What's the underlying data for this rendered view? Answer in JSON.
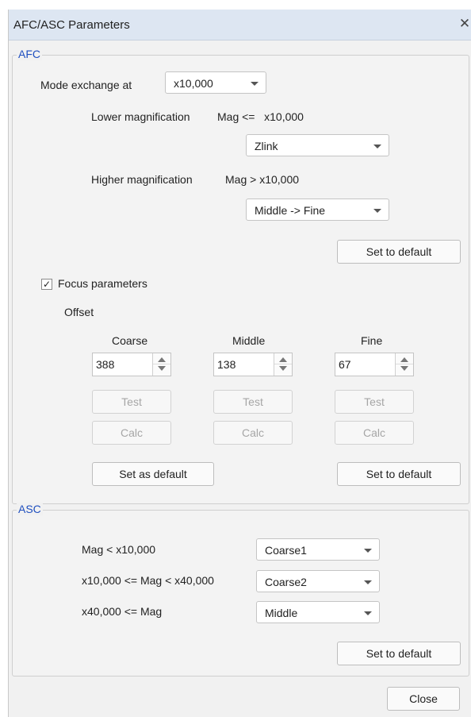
{
  "window": {
    "title": "AFC/ASC Parameters",
    "close_glyph": "✕"
  },
  "afc": {
    "legend": "AFC",
    "mode_exchange_label": "Mode exchange at",
    "mode_exchange_value": "x10,000",
    "lower_mag_label": "Lower magnification",
    "lower_mag_condition": "Mag <=   x10,000",
    "lower_mag_value": "Zlink",
    "higher_mag_label": "Higher magnification",
    "higher_mag_condition": "Mag > x10,000",
    "higher_mag_value": "Middle -> Fine",
    "set_default_label": "Set to default",
    "focus_params_label": "Focus parameters",
    "focus_params_checked": true,
    "check_glyph": "✓",
    "offset_label": "Offset",
    "columns": [
      {
        "name": "Coarse",
        "value": "388",
        "test": "Test",
        "calc": "Calc"
      },
      {
        "name": "Middle",
        "value": "138",
        "test": "Test",
        "calc": "Calc"
      },
      {
        "name": "Fine",
        "value": "67",
        "test": "Test",
        "calc": "Calc"
      }
    ],
    "set_as_default_label": "Set as default",
    "set_default_label_2": "Set to default"
  },
  "asc": {
    "legend": "ASC",
    "rows": [
      {
        "label": "Mag < x10,000",
        "value": "Coarse1"
      },
      {
        "label": "x10,000 <= Mag < x40,000",
        "value": "Coarse2"
      },
      {
        "label": "x40,000 <= Mag",
        "value": "Middle"
      }
    ],
    "set_default_label": "Set to default"
  },
  "footer": {
    "close_label": "Close"
  },
  "colors": {
    "legend": "#1f4fbf",
    "titlebar": "#dde6f2",
    "dialog_bg": "#f1f1f1"
  }
}
